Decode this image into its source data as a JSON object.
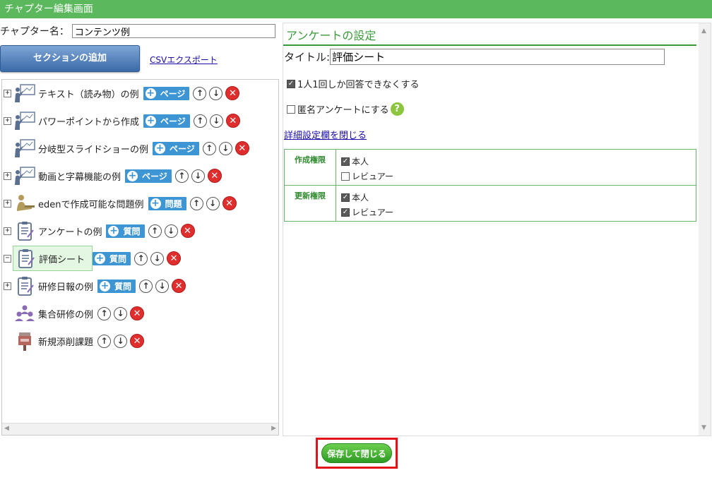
{
  "window": {
    "title": "チャプター編集画面"
  },
  "chapter": {
    "label": "チャプター名：",
    "value": "コンテンツ例"
  },
  "toolbar": {
    "add_section": "セクションの追加",
    "csv_export": "CSVエクスポート"
  },
  "tree": {
    "items": [
      {
        "label": "テキスト（読み物）の例",
        "add_label": "ページ",
        "icon": "presentation-icon",
        "expander": "+"
      },
      {
        "label": "パワーポイントから作成",
        "add_label": "ページ",
        "icon": "presentation-icon",
        "expander": "+"
      },
      {
        "label": "分岐型スライドショーの例",
        "add_label": "ページ",
        "icon": "presentation-icon",
        "expander": ""
      },
      {
        "label": "動画と字幕機能の例",
        "add_label": "ページ",
        "icon": "presentation-icon",
        "expander": "+"
      },
      {
        "label": "edenで作成可能な問題例",
        "add_label": "問題",
        "icon": "exam-icon",
        "expander": "+"
      },
      {
        "label": "アンケートの例",
        "add_label": "質問",
        "icon": "clipboard-icon",
        "expander": "+"
      },
      {
        "label": "評価シート",
        "add_label": "質問",
        "icon": "clipboard-icon",
        "expander": "−",
        "selected": true
      },
      {
        "label": "研修日報の例",
        "add_label": "質問",
        "icon": "clipboard-icon",
        "expander": "+"
      },
      {
        "label": "集合研修の例",
        "add_label": "",
        "icon": "group-icon",
        "expander": ""
      },
      {
        "label": "新規添削課題",
        "add_label": "",
        "icon": "postbox-icon",
        "expander": ""
      }
    ]
  },
  "survey": {
    "heading": "アンケートの設定",
    "title_label": "タイトル:",
    "title_value": "評価シート",
    "once_only": {
      "label": "1人1回しか回答できなくする",
      "checked": true
    },
    "anonymous": {
      "label": "匿名アンケートにする",
      "checked": false
    },
    "detail_link": "詳細設定欄を閉じる",
    "permissions": [
      {
        "heading": "作成権限",
        "options": [
          {
            "label": "本人",
            "checked": true
          },
          {
            "label": "レビュアー",
            "checked": false
          }
        ]
      },
      {
        "heading": "更新権限",
        "options": [
          {
            "label": "本人",
            "checked": true
          },
          {
            "label": "レビュアー",
            "checked": true
          }
        ]
      }
    ]
  },
  "footer": {
    "save_close": "保存して閉じる"
  },
  "colors": {
    "accent": "#5cb85c",
    "add_button": "#3d96d3",
    "delete": "#e02e2e",
    "highlight": "#e4101a"
  }
}
